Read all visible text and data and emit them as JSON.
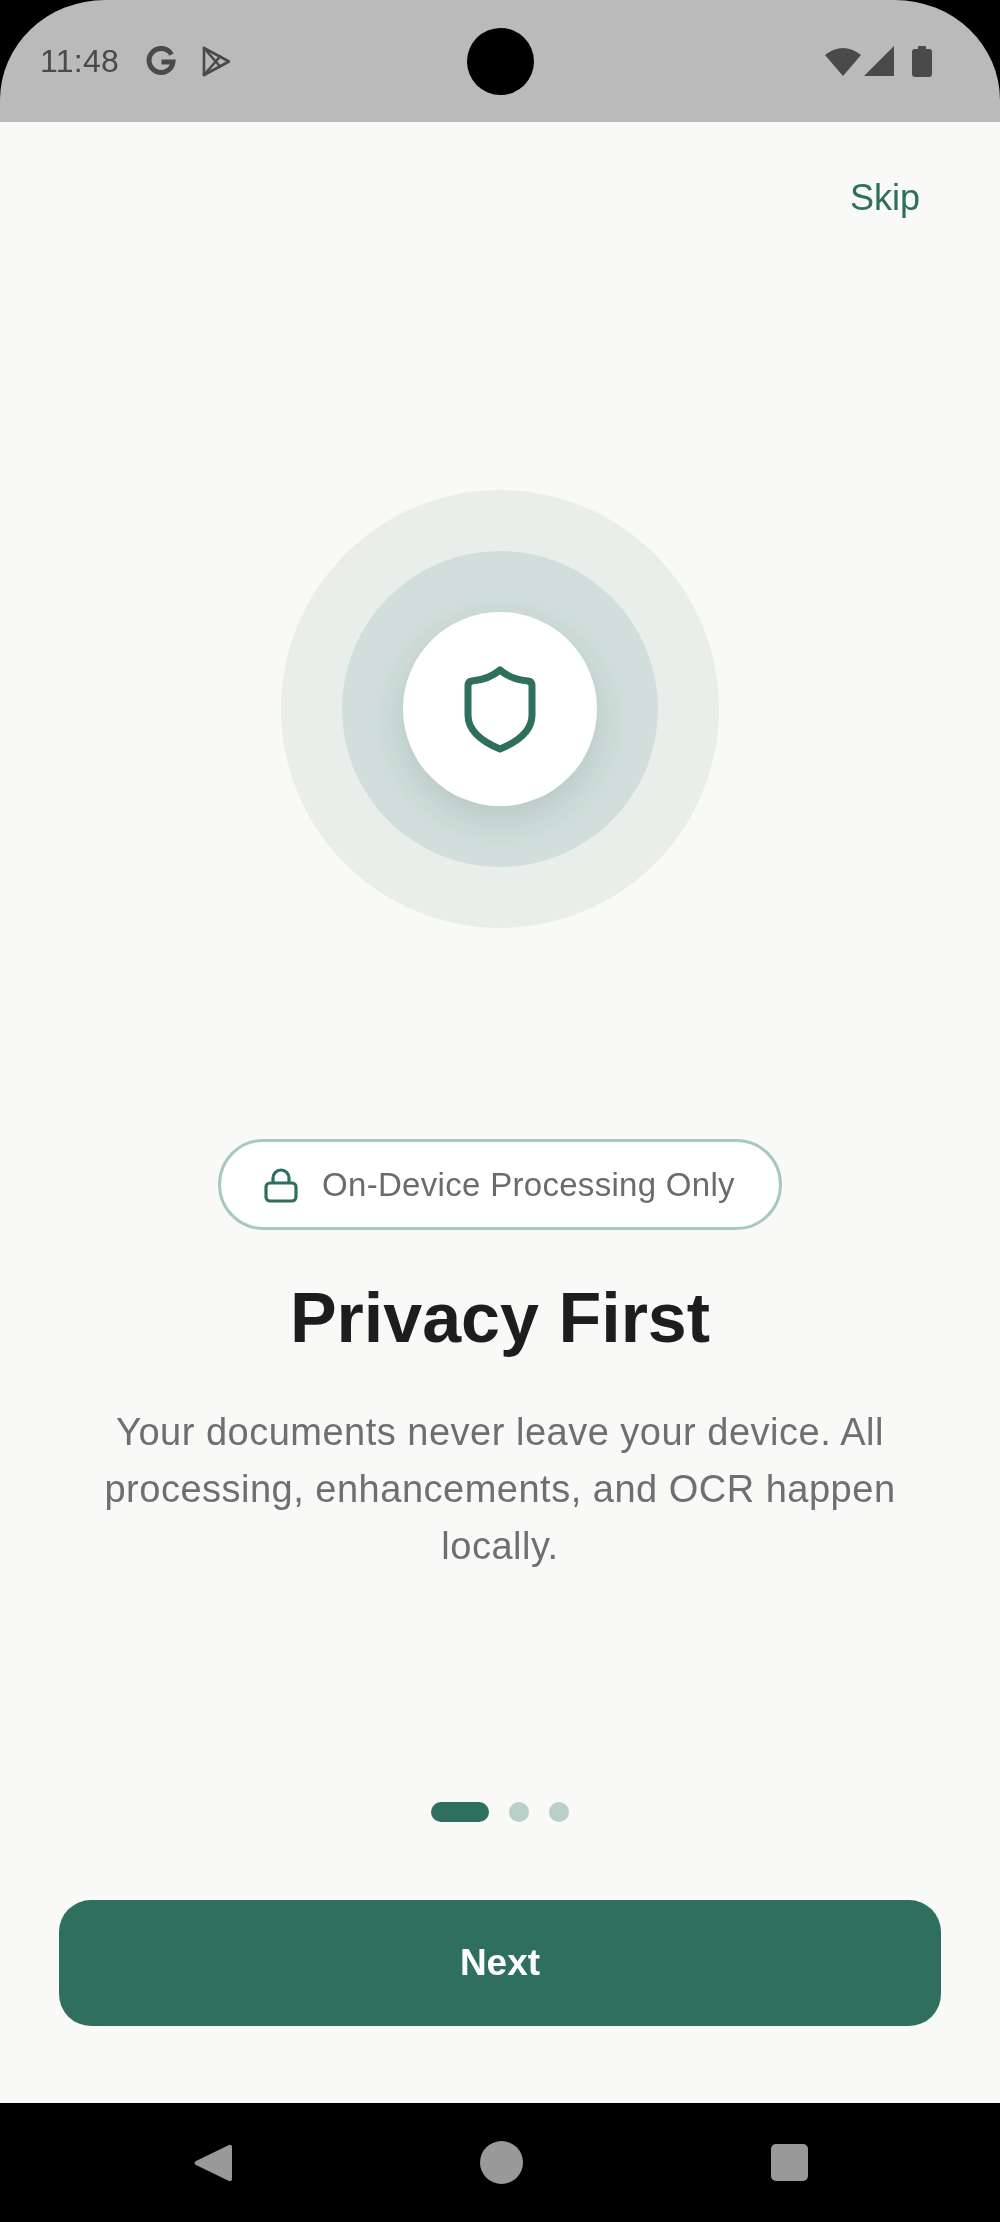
{
  "status_bar": {
    "time": "11:48"
  },
  "skip_button": {
    "label": "Skip"
  },
  "badge": {
    "label": "On-Device Processing Only"
  },
  "title": "Privacy First",
  "description": "Your documents never leave your device. All processing, enhancements, and OCR happen locally.",
  "pager": [
    {
      "selected": true
    },
    {
      "selected": false
    },
    {
      "selected": false
    }
  ],
  "next_button": {
    "label": "Next"
  }
}
